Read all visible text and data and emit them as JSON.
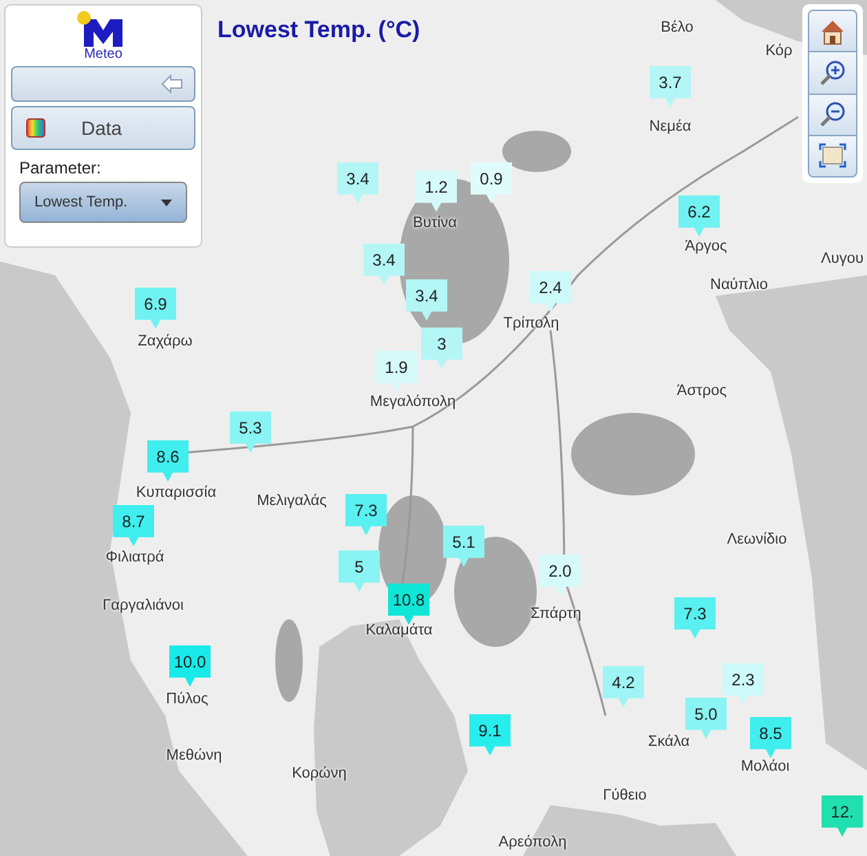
{
  "title": "Lowest Temp. (°C)",
  "panel": {
    "logo_text": "Meteo",
    "data_button": "Data",
    "parameter_label": "Parameter:",
    "parameter_select": "Lowest Temp."
  },
  "places": [
    "Βέλο",
    "Κόρ",
    "Νεμέα",
    "Βυτίνα",
    "Άργος",
    "Λυγου",
    "Ναύπλιο",
    "Τρίπολη",
    "Ζαχάρω",
    "Μεγαλόπολη",
    "Άστρος",
    "Κυπαρισσία",
    "Μελιγαλάς",
    "Λεωνίδιο",
    "Φιλιατρά",
    "Γαργαλιάνοι",
    "Καλαμάτα",
    "Σπάρτη",
    "Πύλος",
    "Σκάλα",
    "Μεθώνη",
    "Μολάοι",
    "Κορώνη",
    "Γύθειο",
    "Αρεόπολη"
  ],
  "markers": [
    {
      "value": "3.7",
      "color": "#b4f6f6"
    },
    {
      "value": "3.4",
      "color": "#b4f6f6"
    },
    {
      "value": "1.2",
      "color": "#d6fafa"
    },
    {
      "value": "0.9",
      "color": "#e0fbfb"
    },
    {
      "value": "6.2",
      "color": "#70f2f2"
    },
    {
      "value": "3.4",
      "color": "#b4f6f6"
    },
    {
      "value": "3.4",
      "color": "#b4f6f6"
    },
    {
      "value": "2.4",
      "color": "#cdf9f9"
    },
    {
      "value": "6.9",
      "color": "#70f2f2"
    },
    {
      "value": "3",
      "color": "#b4f6f6"
    },
    {
      "value": "1.9",
      "color": "#d6fafa"
    },
    {
      "value": "5.3",
      "color": "#8af3f3"
    },
    {
      "value": "8.6",
      "color": "#40eeee"
    },
    {
      "value": "8.7",
      "color": "#40eeee"
    },
    {
      "value": "7.3",
      "color": "#58f0f0"
    },
    {
      "value": "5.1",
      "color": "#8af3f3"
    },
    {
      "value": "2.0",
      "color": "#d6fafa"
    },
    {
      "value": "5",
      "color": "#8af3f3"
    },
    {
      "value": "10.8",
      "color": "#10e6d6"
    },
    {
      "value": "7.3",
      "color": "#58f0f0"
    },
    {
      "value": "4.2",
      "color": "#9ff5f5"
    },
    {
      "value": "2.3",
      "color": "#cdf9f9"
    },
    {
      "value": "10.0",
      "color": "#18eaea"
    },
    {
      "value": "5.0",
      "color": "#8af3f3"
    },
    {
      "value": "9.1",
      "color": "#28eded"
    },
    {
      "value": "8.5",
      "color": "#40eeee"
    },
    {
      "value": "12.",
      "color": "#20e0b0"
    }
  ]
}
